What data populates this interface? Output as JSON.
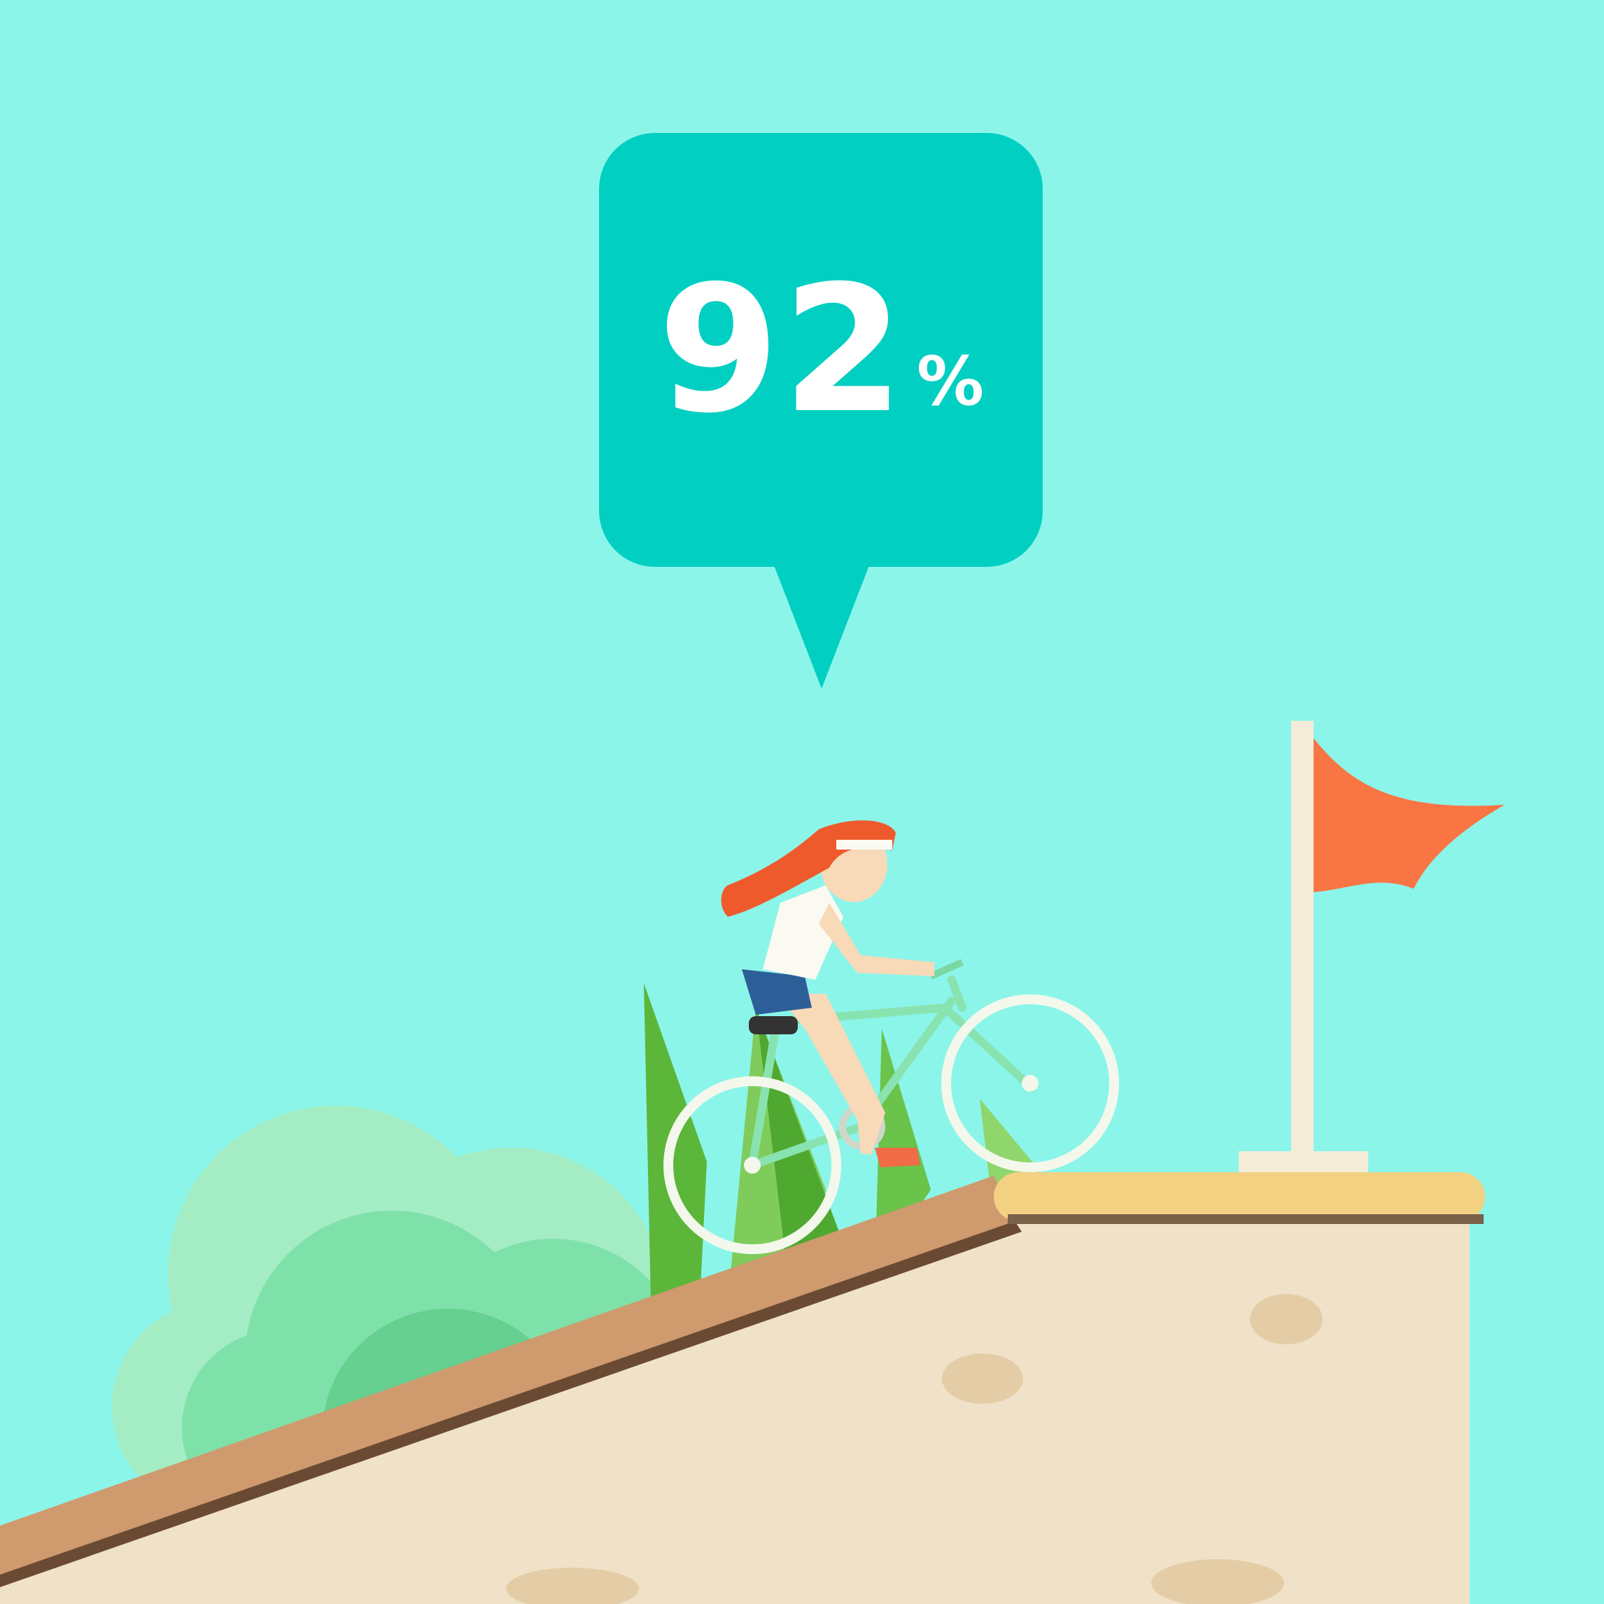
{
  "progress": {
    "value": 92,
    "number": "92",
    "unit": "%"
  },
  "colors": {
    "sky": "#8cf5ea",
    "bubble": "#00cfc1",
    "flag": "#fa7544",
    "pole": "#f3ecd8",
    "hill": "#f0e2c9",
    "slope_edge": "#cf9a6d",
    "plateau_edge": "#f3d182",
    "bush_light": "#a4edc4",
    "bush_mid": "#7fe1aa",
    "bush_dark": "#66d090",
    "grass": "#5cb63a",
    "hair": "#ef5a2c",
    "bike": "#88e3b0"
  },
  "icons": {
    "scene": "cyclist-uphill-illustration",
    "goal": "flag-icon"
  }
}
